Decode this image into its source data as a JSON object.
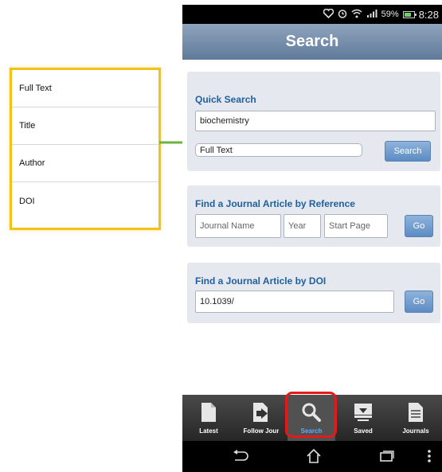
{
  "dropdown": {
    "options": [
      "Full Text",
      "Title",
      "Author",
      "DOI"
    ]
  },
  "status_bar": {
    "battery_percent": "59%",
    "time": "8:28"
  },
  "header": {
    "title": "Search"
  },
  "quick_search": {
    "title": "Quick Search",
    "query_value": "biochemistry",
    "scope_value": "Full Text",
    "search_button": "Search"
  },
  "reference_search": {
    "title": "Find a Journal Article by Reference",
    "journal_placeholder": "Journal Name",
    "year_placeholder": "Year",
    "start_page_placeholder": "Start Page",
    "go_button": "Go"
  },
  "doi_search": {
    "title": "Find a Journal Article by DOI",
    "doi_value": "10.1039/",
    "go_button": "Go"
  },
  "tabs": [
    {
      "label": "Latest",
      "icon": "document-icon"
    },
    {
      "label": "Follow Jour",
      "icon": "follow-journal-icon"
    },
    {
      "label": "Search",
      "icon": "search-icon"
    },
    {
      "label": "Saved",
      "icon": "saved-tray-icon"
    },
    {
      "label": "Journals",
      "icon": "journals-icon"
    }
  ],
  "active_tab": "Search",
  "colors": {
    "header_gradient_top": "#8fa4bd",
    "header_gradient_bottom": "#5f7a99",
    "card_background": "#e5e8ee",
    "card_title": "#1f5f9e",
    "button_blue": "#6f9bcf",
    "callout_border": "#f2c21b",
    "arrow_green": "#6db33f",
    "highlight_ring": "#e21a1a"
  }
}
